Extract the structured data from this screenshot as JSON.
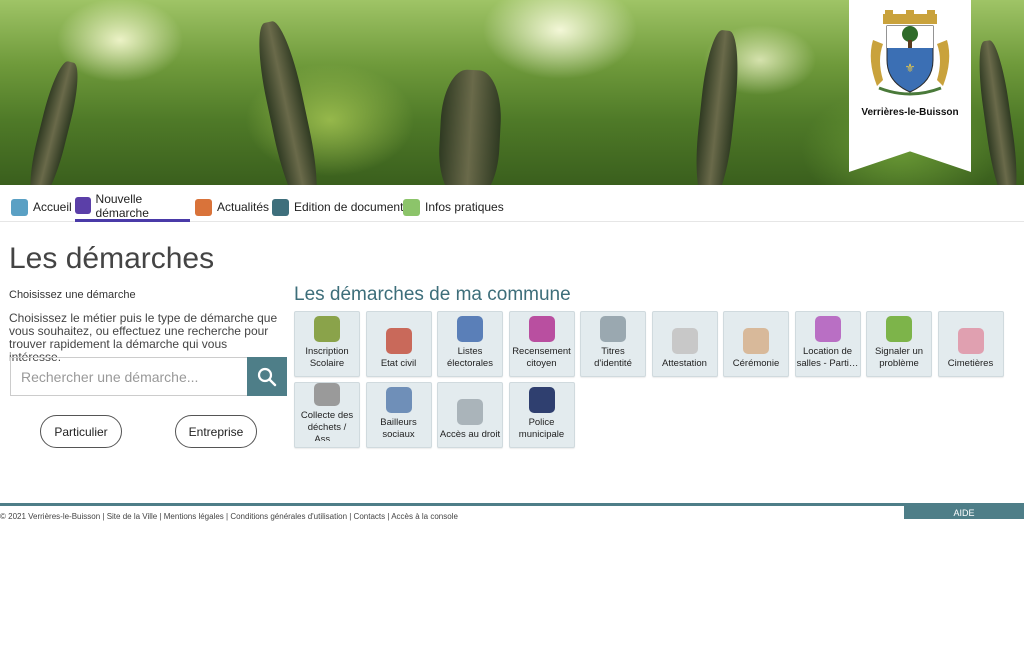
{
  "brand": {
    "commune_name": "Verrières-le-Buisson"
  },
  "nav": {
    "items": [
      {
        "label": "Accueil"
      },
      {
        "label": "Nouvelle démarche"
      },
      {
        "label": "Actualités"
      },
      {
        "label": "Edition de documents"
      },
      {
        "label": "Infos pratiques"
      }
    ]
  },
  "main": {
    "title": "Les démarches",
    "subtitle": "Choisissez une démarche",
    "description": "Choisissez le métier puis le type de démarche que vous souhaitez, ou effectuez une recherche pour trouver rapidement la démarche qui vous intéresse.",
    "search": {
      "placeholder": "Rechercher une démarche..."
    },
    "profile_buttons": {
      "particulier": "Particulier",
      "entreprise": "Entreprise"
    }
  },
  "commune": {
    "title": "Les démarches de ma commune",
    "tiles": [
      {
        "label": "Inscription Scolaire",
        "icon": "school-bag-icon",
        "color": "#8aa34a"
      },
      {
        "label": "Etat civil",
        "icon": "civil-registry-icon",
        "color": "#c9695a"
      },
      {
        "label": "Listes électorales",
        "icon": "ballot-card-icon",
        "color": "#5a7fb8"
      },
      {
        "label": "Recensement citoyen",
        "icon": "census-icon",
        "color": "#b94fa0"
      },
      {
        "label": "Titres d'identité",
        "icon": "id-card-icon",
        "color": "#9aa8b0"
      },
      {
        "label": "Attestation",
        "icon": "document-icon",
        "color": "#c8c8c8"
      },
      {
        "label": "Cérémonie",
        "icon": "handshake-icon",
        "color": "#d8b99a"
      },
      {
        "label": "Location de salles - Parti…",
        "icon": "house-search-icon",
        "color": "#b96fc4"
      },
      {
        "label": "Signaler un problème",
        "icon": "tree-signal-icon",
        "color": "#7db44a"
      },
      {
        "label": "Cimetières",
        "icon": "flower-icon",
        "color": "#e0a0b0"
      },
      {
        "label": "Collecte des déchets / Ass…",
        "icon": "trash-bin-icon",
        "color": "#9a9a9a"
      },
      {
        "label": "Bailleurs sociaux",
        "icon": "building-icon",
        "color": "#6f8fb8"
      },
      {
        "label": "Accès au droit",
        "icon": "speech-bubble-icon",
        "color": "#aab4ba"
      },
      {
        "label": "Police municipale",
        "icon": "police-icon",
        "color": "#2f3f6f"
      }
    ]
  },
  "footer": {
    "text": "© 2021 Verrières-le-Buisson | Site de la Ville | Mentions légales | Conditions générales d'utilisation | Contacts | Accès à la console",
    "help": "AIDE"
  },
  "colors": {
    "accent": "#4e7e88",
    "nav_active": "#4a3aa8"
  }
}
